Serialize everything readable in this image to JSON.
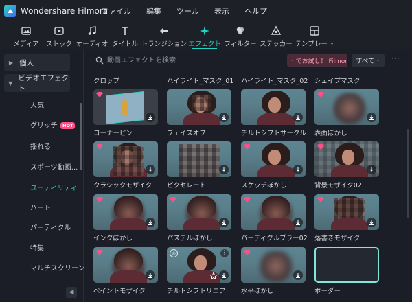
{
  "app": {
    "name": "Wondershare Filmora"
  },
  "menu": [
    "ファイル",
    "編集",
    "ツール",
    "表示",
    "ヘルプ"
  ],
  "toolbar": [
    {
      "label": "メディア",
      "icon": "media-icon"
    },
    {
      "label": "ストック",
      "icon": "stock-icon"
    },
    {
      "label": "オーディオ",
      "icon": "music-note-icon"
    },
    {
      "label": "タイトル",
      "icon": "text-t-icon"
    },
    {
      "label": "トランジション",
      "icon": "transition-icon"
    },
    {
      "label": "エフェクト",
      "icon": "effects-sparkle-icon",
      "active": true
    },
    {
      "label": "フィルター",
      "icon": "filter-icon"
    },
    {
      "label": "ステッカー",
      "icon": "sticker-icon"
    },
    {
      "label": "テンプレート",
      "icon": "template-icon"
    }
  ],
  "sidebar": {
    "personal": "個人",
    "video_effects": "ビデオエフェクト",
    "sub": [
      "人気",
      "グリッチ",
      "揺れる",
      "スポーツ動画...",
      "ユーティリティ",
      "ハート",
      "パーティクル",
      "特集",
      "マルチスクリーン"
    ],
    "hot": "HOT"
  },
  "search": {
    "placeholder": "動画エフェクトを検索"
  },
  "trial": "でお試し！ Filmor",
  "filter": {
    "selected": "すべて"
  },
  "columns": [
    "クロップ",
    "ハイライト_マスク_01",
    "ハイライト_マスク_02",
    "シェイプマスク"
  ],
  "effects": [
    "コーナーピン",
    "フェイスオフ",
    "チルトシフトサークル",
    "表面ぼかし",
    "クラシックモザイク",
    "ピクセレート",
    "スケッチぼかし",
    "背景モザイク02",
    "インクぼかし",
    "パステルぼかし",
    "パーティクルブラー02",
    "落書きモザイク",
    "ペイントモザイク",
    "チルトシフトリニア",
    "水平ぼかし",
    "ボーダー"
  ],
  "colors": {
    "accent": "#22d3c5",
    "premium": "#ff4f86",
    "hot": "#ff4f86"
  }
}
